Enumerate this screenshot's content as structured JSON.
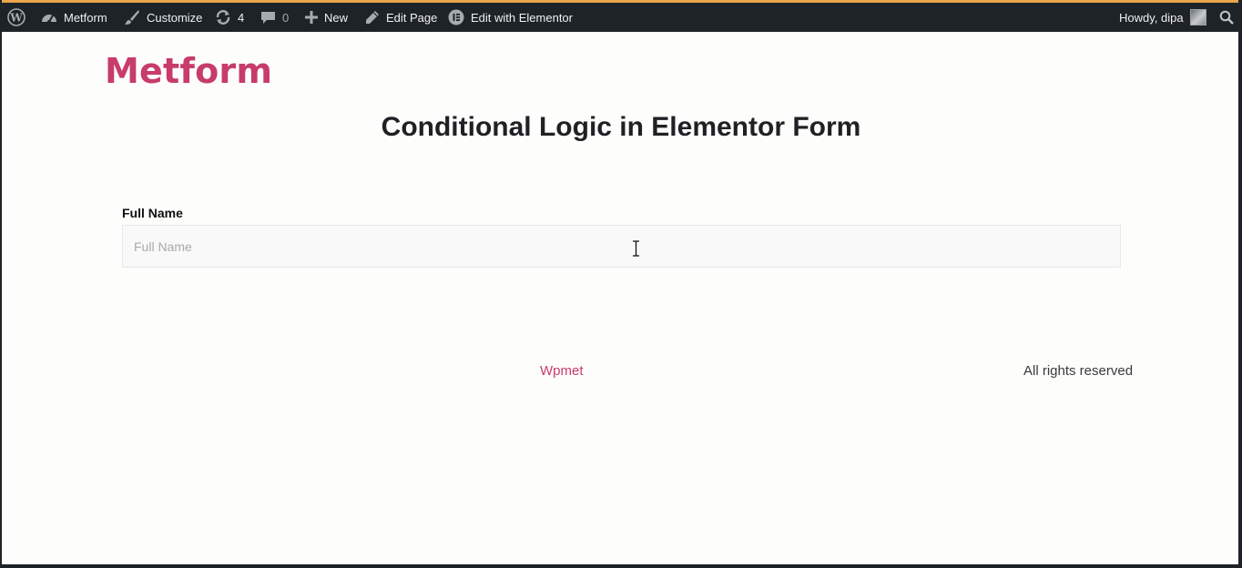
{
  "admin_bar": {
    "site_name": "Metform",
    "customize": "Customize",
    "updates_count": "4",
    "comments_count": "0",
    "new": "New",
    "edit_page": "Edit Page",
    "edit_with_elementor": "Edit with Elementor",
    "greeting": "Howdy, dipa"
  },
  "site": {
    "title": "Metform"
  },
  "page": {
    "heading": "Conditional Logic in Elementor Form"
  },
  "form": {
    "full_name_label": "Full Name",
    "full_name_placeholder": "Full Name",
    "full_name_value": ""
  },
  "footer": {
    "link": "Wpmet",
    "rights": "All rights reserved"
  },
  "colors": {
    "accent": "#c73c6a",
    "admin_bar": "#1d2327",
    "heading": "#1f2124"
  },
  "icons": {
    "wordpress": "wordpress-logo-icon",
    "dashboard": "dashboard-icon",
    "customize": "brush-icon",
    "updates": "updates-icon",
    "comments": "comment-icon",
    "new": "plus-icon",
    "edit": "pencil-icon",
    "elementor": "elementor-icon",
    "search": "search-icon",
    "cursor": "text-cursor-icon"
  }
}
